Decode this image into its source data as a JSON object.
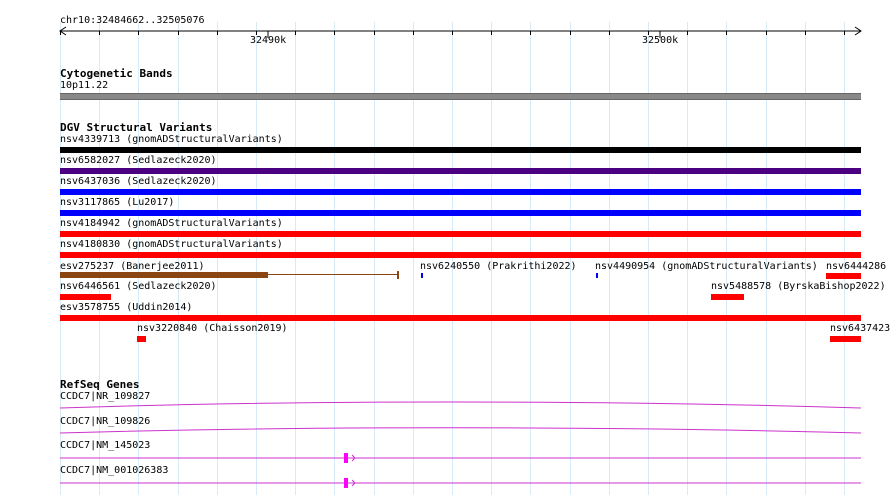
{
  "colors": {
    "grid": "#d6eaf8",
    "black": "#000000",
    "purple": "#4b0082",
    "blue": "#0000ff",
    "red": "#ff0000",
    "brown": "#8b4513",
    "gene": "#cc33cc"
  },
  "ruler": {
    "location": "chr10:32484662..32505076",
    "tick_32490k": "32490k",
    "tick_32500k": "32500k"
  },
  "cytogenetic": {
    "title": "Cytogenetic Bands",
    "band": "10p11.22"
  },
  "dgv": {
    "title": "DGV Structural Variants",
    "variants": [
      {
        "label": "nsv4339713 (gnomADStructuralVariants)",
        "color": "black"
      },
      {
        "label": "nsv6582027 (Sedlazeck2020)",
        "color": "purple"
      },
      {
        "label": "nsv6437036 (Sedlazeck2020)",
        "color": "blue"
      },
      {
        "label": "nsv3117865 (Lu2017)",
        "color": "blue"
      },
      {
        "label": "nsv4184942 (gnomADStructuralVariants)",
        "color": "red"
      },
      {
        "label": "nsv4180830 (gnomADStructuralVariants)",
        "color": "red"
      },
      {
        "label": "esv275237 (Banerjee2011)",
        "color": "brown"
      },
      {
        "label": "nsv6240550 (Prakrithi2022)",
        "color": "blue"
      },
      {
        "label": "nsv4490954 (gnomADStructuralVariants)",
        "color": "blue"
      },
      {
        "label": "nsv6444286",
        "color": "red"
      },
      {
        "label": "nsv6446561 (Sedlazeck2020)",
        "color": "red"
      },
      {
        "label": "nsv5488578 (ByrskaBishop2022)",
        "color": "red"
      },
      {
        "label": "esv3578755 (Uddin2014)",
        "color": "red"
      },
      {
        "label": "nsv3220840 (Chaisson2019)",
        "color": "red"
      },
      {
        "label": "nsv6437423",
        "color": "red"
      }
    ]
  },
  "refseq": {
    "title": "RefSeq Genes",
    "genes": [
      {
        "label": "CCDC7|NR_109827"
      },
      {
        "label": "CCDC7|NR_109826"
      },
      {
        "label": "CCDC7|NM_145023"
      },
      {
        "label": "CCDC7|NM_001026383"
      }
    ]
  }
}
